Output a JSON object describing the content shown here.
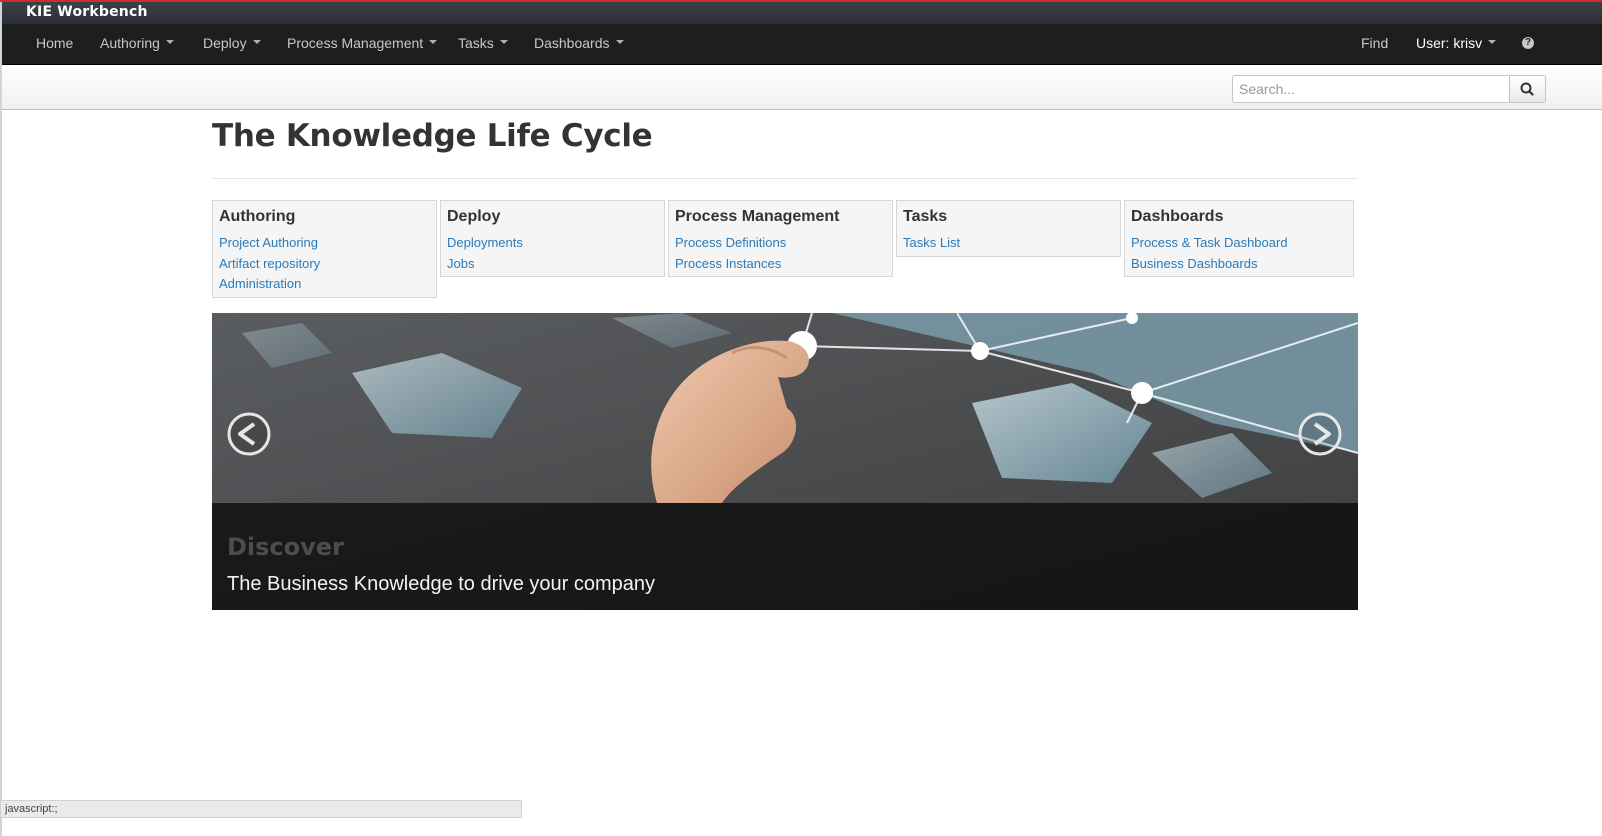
{
  "app": {
    "title": "KIE Workbench"
  },
  "nav": {
    "items": [
      {
        "label": "Home",
        "dropdown": false
      },
      {
        "label": "Authoring",
        "dropdown": true
      },
      {
        "label": "Deploy",
        "dropdown": true
      },
      {
        "label": "Process Management",
        "dropdown": true
      },
      {
        "label": "Tasks",
        "dropdown": true
      },
      {
        "label": "Dashboards",
        "dropdown": true
      }
    ],
    "find_label": "Find",
    "user_label": "User: krisv",
    "help_icon": "question-circle-icon"
  },
  "search": {
    "placeholder": "Search...",
    "value": "",
    "button_icon": "search-icon"
  },
  "page": {
    "title": "The Knowledge Life Cycle"
  },
  "panels": [
    {
      "title": "Authoring",
      "links": [
        "Project Authoring",
        "Artifact repository",
        "Administration"
      ]
    },
    {
      "title": "Deploy",
      "links": [
        "Deployments",
        "Jobs"
      ]
    },
    {
      "title": "Process Management",
      "links": [
        "Process Definitions",
        "Process Instances"
      ]
    },
    {
      "title": "Tasks",
      "links": [
        "Tasks List"
      ]
    },
    {
      "title": "Dashboards",
      "links": [
        "Process & Task Dashboard",
        "Business Dashboards"
      ]
    }
  ],
  "carousel": {
    "heading": "Discover",
    "text": "The Business Knowledge to drive your company",
    "prev_icon": "chevron-left-circle-icon",
    "next_icon": "chevron-right-circle-icon"
  },
  "status": {
    "text": "javascript:;"
  },
  "colors": {
    "accent_red": "#c9302c",
    "navbar_bg": "#1e1e1e",
    "link_blue": "#2a7ab8",
    "panel_bg": "#f5f5f5"
  }
}
